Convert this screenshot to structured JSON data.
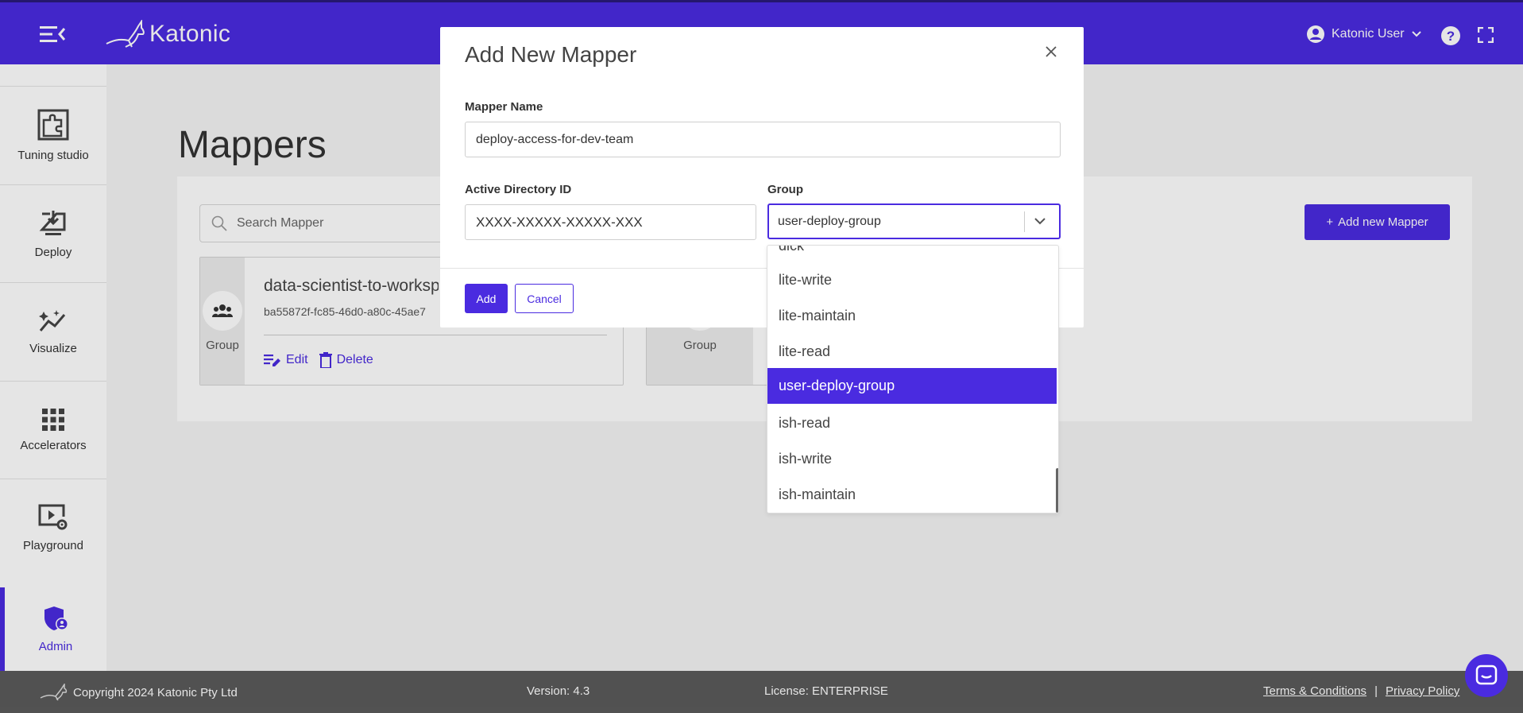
{
  "brand": {
    "name": "Katonic",
    "accent": "#4a2be0"
  },
  "header": {
    "user_name": "Katonic User"
  },
  "sidebar": {
    "items": [
      {
        "label": "Tuning studio",
        "icon": "puzzle-icon"
      },
      {
        "label": "Deploy",
        "icon": "deploy-icon"
      },
      {
        "label": "Visualize",
        "icon": "visualize-icon"
      },
      {
        "label": "Accelerators",
        "icon": "grid-icon"
      },
      {
        "label": "Playground",
        "icon": "playground-icon"
      },
      {
        "label": "Admin",
        "icon": "admin-shield-icon",
        "active": true
      }
    ]
  },
  "main": {
    "title": "Mappers",
    "search_placeholder": "Search Mapper",
    "add_button": "Add new Mapper",
    "cards": [
      {
        "title": "data-scientist-to-workspace",
        "id": "ba55872f-fc85-46d0-a80c-45ae7",
        "type_label": "Group",
        "edit_label": "Edit",
        "delete_label": "Delete"
      },
      {
        "type_label": "Group"
      }
    ]
  },
  "modal": {
    "title": "Add New Mapper",
    "mapper_name_label": "Mapper Name",
    "mapper_name_value": "deploy-access-for-dev-team",
    "ad_id_label": "Active Directory ID",
    "ad_id_value": "XXXX-XXXXX-XXXXX-XXX",
    "group_label": "Group",
    "group_value": "user-deploy-group",
    "add_button": "Add",
    "cancel_button": "Cancel"
  },
  "dropdown": {
    "partial_option": "dick",
    "options": [
      "lite-write",
      "lite-maintain",
      "lite-read",
      "user-deploy-group",
      "ish-read",
      "ish-write",
      "ish-maintain"
    ],
    "selected": "user-deploy-group"
  },
  "footer": {
    "copyright": "Copyright 2024 Katonic Pty Ltd",
    "version": "Version: 4.3",
    "license": "License: ENTERPRISE",
    "terms": "Terms & Conditions",
    "separator": "|",
    "privacy": "Privacy Policy"
  }
}
